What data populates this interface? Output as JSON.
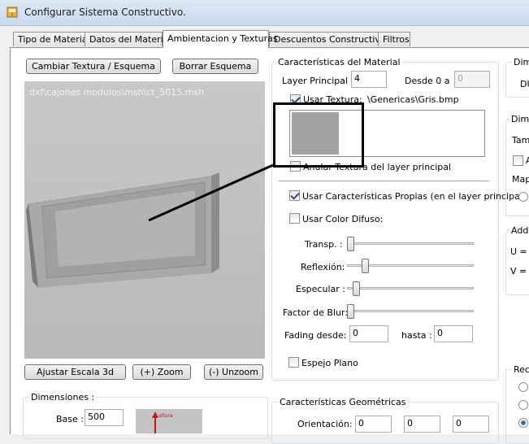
{
  "window": {
    "title": "Configurar Sistema Constructivo."
  },
  "tabs": [
    {
      "label": "Tipo de Material"
    },
    {
      "label": "Datos del Material"
    },
    {
      "label": "Ambientacion y Texturas"
    },
    {
      "label": "Descuentos Constructivos"
    },
    {
      "label": "Filtros"
    }
  ],
  "viewer": {
    "change_texture_label": "Cambiar Textura / Esquema",
    "delete_scheme_label": "Borrar Esquema",
    "file_path": "dxf\\cajones modulos\\msh\\ct_5015.msh",
    "adjust_scale_label": "Ajustar Escala 3d",
    "zoom_label": "(+) Zoom",
    "unzoom_label": "(-) Unzoom"
  },
  "dimensiones": {
    "title": "Dimensiones :",
    "base_label": "Base :",
    "base_value": "500",
    "preview_text": "altura"
  },
  "material": {
    "group_title": "Características del Material",
    "layer_label": "Layer Principal :",
    "layer_value": "4",
    "desde_label": "Desde 0 a",
    "desde_value": "0",
    "usar_textura_label": "Usar Textura:",
    "textura_path": "\\Genericas\\Gris.bmp",
    "anular_label": "Anular Textura del layer principal",
    "propias_label": "Usar Características Propias (en el layer principal)",
    "color_difuso_label": "Usar Color Difuso:",
    "transp_label": "Transp. :",
    "reflexion_label": "Reflexión:",
    "especular_label": "Especular :",
    "blur_label": "Factor de Blur:",
    "fading_label": "Fading desde:",
    "fading_value": "0",
    "hasta_label": "hasta :",
    "hasta_value": "0",
    "espejo_label": "Espejo Plano",
    "transp_level": 0.0,
    "reflexion_level": 0.12,
    "especular_level": 0.05,
    "blur_level": 0.0,
    "texture_color": "#a3a4a1"
  },
  "geometricas": {
    "title": "Características Geométricas",
    "orient_label": "Orientación:",
    "orient_values": [
      "0",
      "0",
      "0"
    ]
  },
  "right": {
    "dim_title": "Dim",
    "dim_text": "DU",
    "dim2_title": "Dime",
    "tam_label": "Tam",
    "chk_label": "A",
    "map_label": "Map",
    "addr_title": "Addr",
    "u_label": "U =",
    "v_label": "V =",
    "rec_title": "Rec"
  }
}
